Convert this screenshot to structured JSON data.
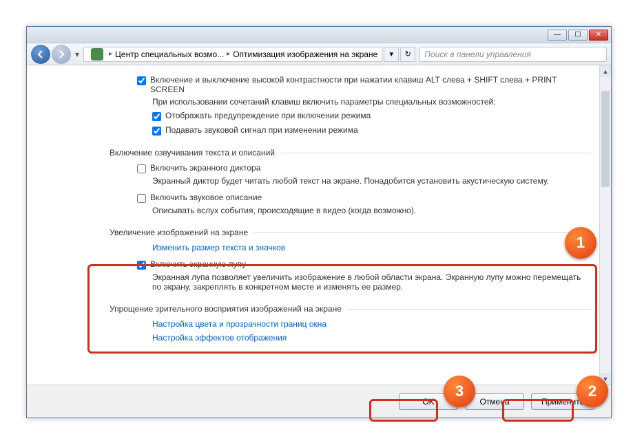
{
  "breadcrumb": {
    "part1": "Центр специальных возмо...",
    "part2": "Оптимизация изображения на экране"
  },
  "search_placeholder": "Поиск в панели управления",
  "sect1": {
    "chk_contrast": "Включение и выключение высокой контрастности при нажатии клавиш ALT слева + SHIFT слева + PRINT SCREEN",
    "hint": "При использовании сочетаний клавиш включить параметры специальных возможностей:",
    "chk_warn": "Отображать предупреждение при включении режима",
    "chk_sound": "Подавать звуковой сигнал при изменении режима"
  },
  "sect2": {
    "title": "Включение озвучивания текста и описаний",
    "chk_narrator": "Включить экранного диктора",
    "narrator_hint": "Экранный диктор будет читать любой текст на экране. Понадобится установить акустическую систему.",
    "chk_audiodesc": "Включить звуковое описание",
    "audiodesc_hint": "Описывать вслух события, происходящие в видео (когда возможно)."
  },
  "sect3": {
    "title": "Увеличение изображений на экране",
    "link_resize": "Изменить размер текста и значков",
    "chk_magnifier": "Включить экранную лупу",
    "magnifier_hint": "Экранная лупа позволяет увеличить изображение в любой области экрана. Экранную лупу можно перемещать по экрану, закреплять в конкретном месте и изменять ее размер."
  },
  "sect4": {
    "title": "Упрощение зрительного восприятия изображений на экране",
    "link_colors": "Настройка цвета и прозрачности границ окна",
    "link_effects": "Настройка эффектов отображения"
  },
  "buttons": {
    "ok": "OK",
    "cancel": "Отмена",
    "apply": "Применить"
  },
  "markers": {
    "m1": "1",
    "m2": "2",
    "m3": "3"
  }
}
